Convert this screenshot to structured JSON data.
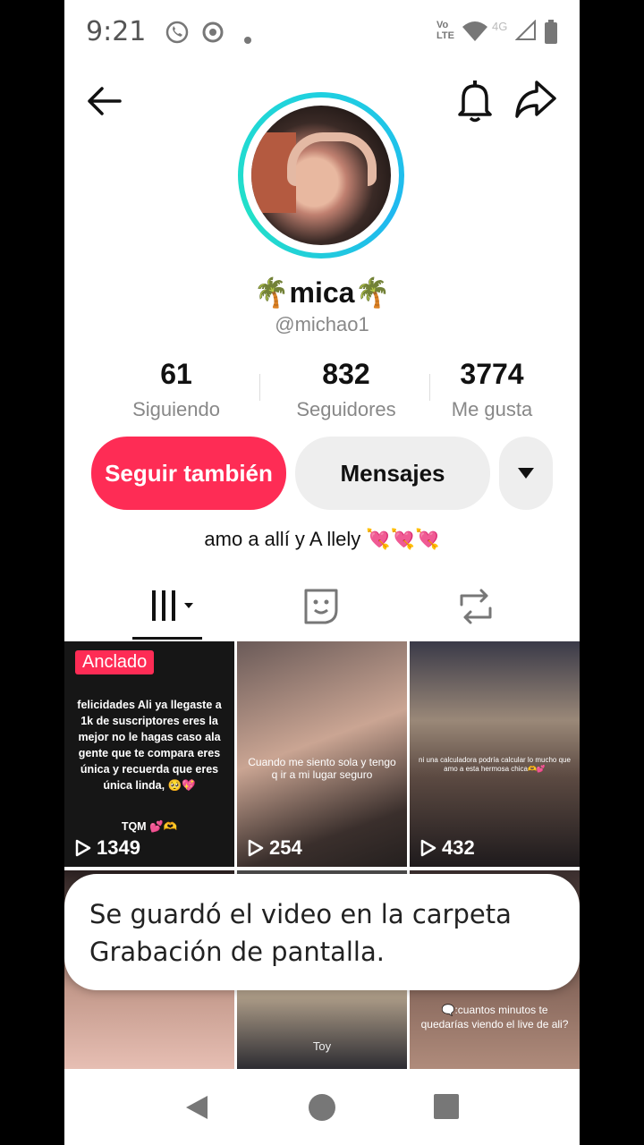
{
  "status_bar": {
    "time": "9:21",
    "network": "4G"
  },
  "profile": {
    "name": "🌴mica🌴",
    "handle": "@michao1",
    "stats": [
      {
        "value": "61",
        "label": "Siguiendo"
      },
      {
        "value": "832",
        "label": "Seguidores"
      },
      {
        "value": "3774",
        "label": "Me gusta"
      }
    ],
    "buttons": {
      "follow": "Seguir también",
      "message": "Mensajes"
    },
    "bio": "amo a allí y A llely 💘💘💘"
  },
  "tabs": [
    "videos-grid-icon",
    "favorites-icon",
    "reposts-icon"
  ],
  "videos": [
    {
      "pinned_label": "Anclado",
      "caption": "felicidades Ali ya llegaste a 1k de suscriptores eres la mejor no le hagas caso ala gente que te compara eres única y recuerda que eres única linda, 🥺💖",
      "footer": "TQM 💕🫶",
      "views": "1349"
    },
    {
      "caption": "Cuando me siento sola y tengo q ir a mi lugar seguro",
      "views": "254"
    },
    {
      "caption": "ni una calculadora podría calcular lo mucho que amo a esta hermosa chica🫶💕",
      "views": "432"
    },
    {
      "caption": "",
      "views": ""
    },
    {
      "caption": "Toy",
      "views": ""
    },
    {
      "caption": "🗨️:cuantos minutos te quedarías viendo el live de ali?",
      "views": ""
    }
  ],
  "toast": {
    "message": "Se guardó el video en la carpeta Grabación de pantalla."
  },
  "colors": {
    "accent": "#fe2c55",
    "ring": "#1fd0e0"
  }
}
